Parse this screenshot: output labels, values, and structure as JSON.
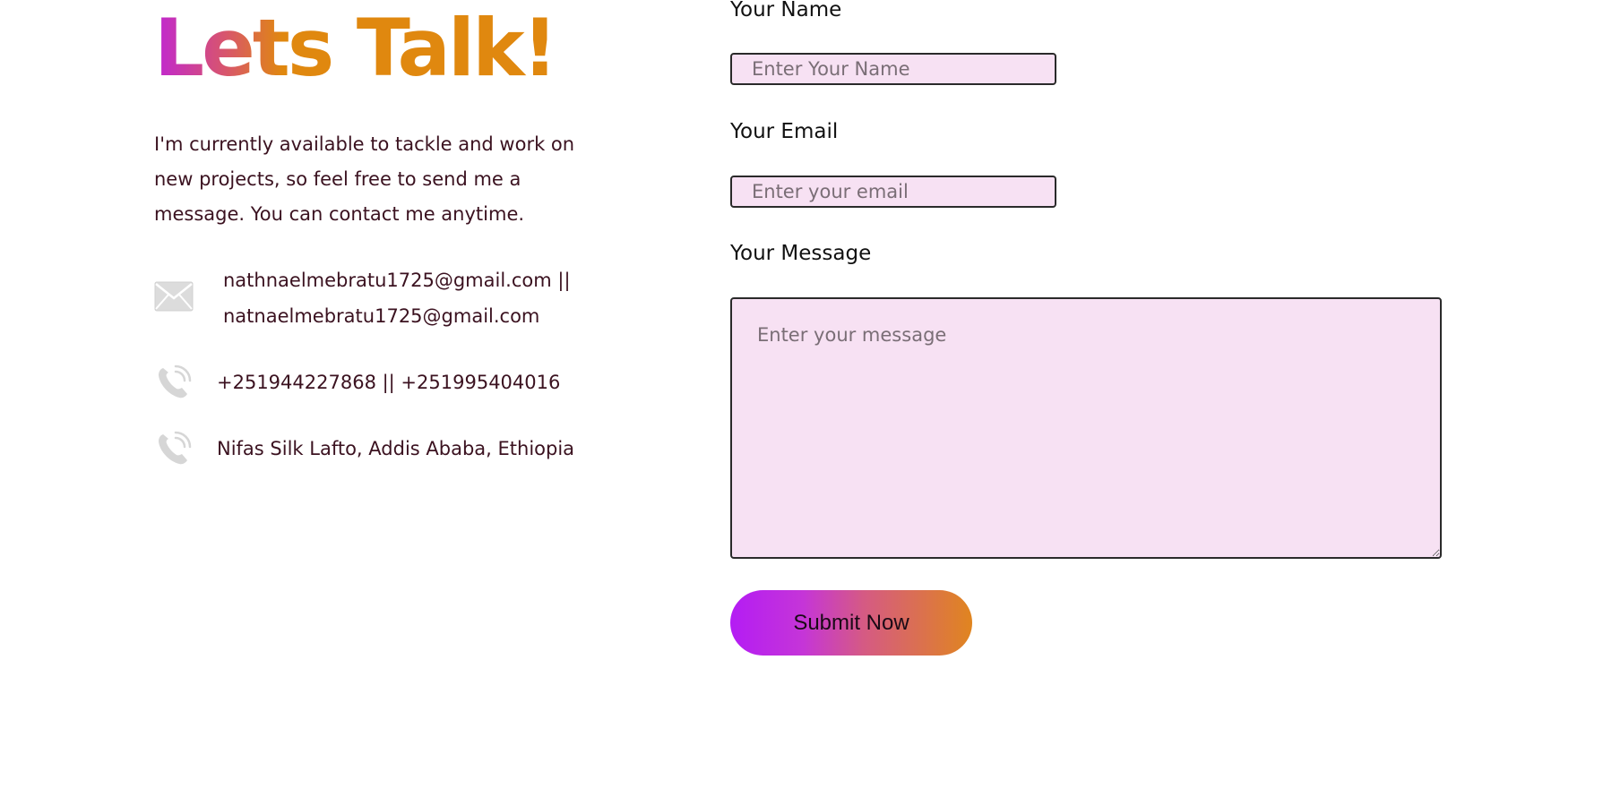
{
  "contact": {
    "title": "Lets Talk!",
    "intro": "I'm currently available to tackle and work on new projects, so feel free to send me a message. You can contact me anytime.",
    "email": "nathnaelmebratu1725@gmail.com || natnaelmebratu1725@gmail.com",
    "phone": "+251944227868 || +251995404016",
    "address": "Nifas Silk Lafto, Addis Ababa, Ethiopia",
    "icons": {
      "email": "envelope-icon",
      "phone": "phone-icon",
      "address": "phone-icon"
    },
    "colors": {
      "text": "#3b1220",
      "title_start": "#c026d3",
      "title_end": "#e0880f",
      "icon": "#d4d4d4"
    }
  },
  "form": {
    "name_label": "Your Name",
    "name_placeholder": "Enter Your Name",
    "name_value": "",
    "email_label": "Your Email",
    "email_placeholder": "Enter your email",
    "email_value": "",
    "message_label": "Your Message",
    "message_placeholder": "Enter your message",
    "message_value": "",
    "submit_label": "Submit Now",
    "colors": {
      "field_bg": "#f7e1f3",
      "field_border": "#2a2a2a",
      "button_start": "#b41cf4",
      "button_end": "#e0851f"
    }
  }
}
